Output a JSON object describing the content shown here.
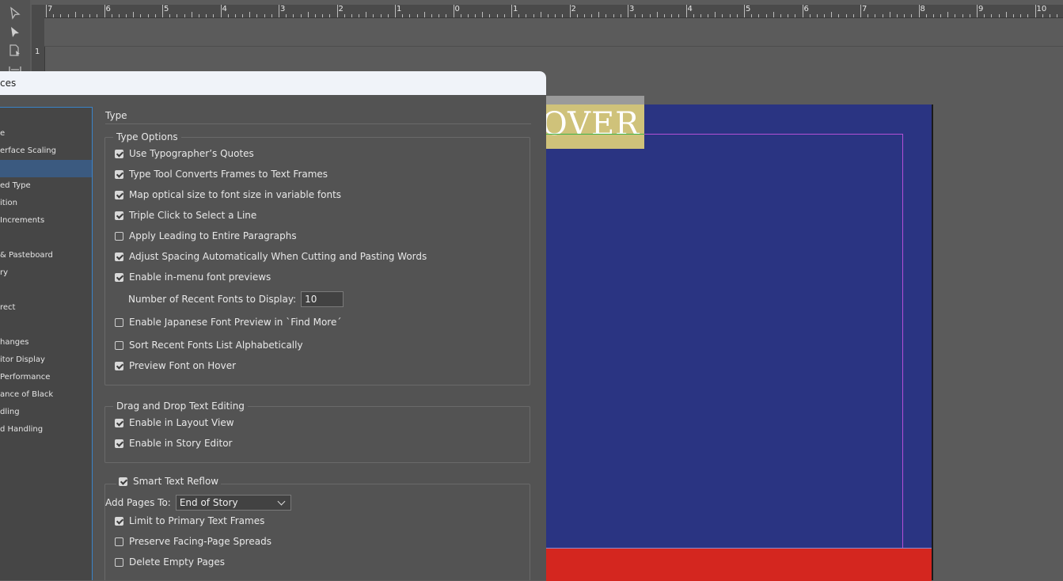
{
  "ruler": {
    "top_numbers": [
      "7",
      "6",
      "5",
      "4",
      "3",
      "2",
      "1",
      "0",
      "1",
      "2",
      "3",
      "4",
      "5",
      "6",
      "7",
      "8",
      "9",
      "10"
    ],
    "left_number": "1"
  },
  "canvas": {
    "cover_text": "OVER",
    "page_color": "#2a3482",
    "band_color": "#d4261f"
  },
  "dialog": {
    "title": "ces",
    "categories": [
      {
        "label": "e",
        "selected": false
      },
      {
        "label": "erface Scaling",
        "selected": false
      },
      {
        "label": "",
        "selected": true
      },
      {
        "label": "ed Type",
        "selected": false
      },
      {
        "label": "ition",
        "selected": false
      },
      {
        "label": " Increments",
        "selected": false
      },
      {
        "label": "",
        "selected": false
      },
      {
        "label": "& Pasteboard",
        "selected": false
      },
      {
        "label": "ry",
        "selected": false
      },
      {
        "label": "",
        "selected": false
      },
      {
        "label": "rect",
        "selected": false
      },
      {
        "label": "",
        "selected": false
      },
      {
        "label": "hanges",
        "selected": false
      },
      {
        "label": "itor Display",
        "selected": false
      },
      {
        "label": " Performance",
        "selected": false
      },
      {
        "label": "ance of Black",
        "selected": false
      },
      {
        "label": "dling",
        "selected": false
      },
      {
        "label": "d Handling",
        "selected": false
      }
    ],
    "section_title": "Type",
    "type_options": {
      "legend": "Type Options",
      "items": [
        {
          "label": "Use Typographer’s Quotes",
          "checked": true
        },
        {
          "label": "Type Tool Converts Frames to Text Frames",
          "checked": true
        },
        {
          "label": "Map optical size to font size in variable fonts",
          "checked": true
        },
        {
          "label": "Triple Click to Select a Line",
          "checked": true
        },
        {
          "label": "Apply Leading to Entire Paragraphs",
          "checked": false
        },
        {
          "label": "Adjust Spacing Automatically When Cutting and Pasting Words",
          "checked": true
        },
        {
          "label": "Enable in-menu font previews",
          "checked": true
        }
      ],
      "recent_fonts_label": "Number of Recent Fonts to Display:",
      "recent_fonts_value": "10",
      "items2": [
        {
          "label": "Enable Japanese Font Preview in `Find More´",
          "checked": false
        },
        {
          "label": "Sort Recent Fonts List Alphabetically",
          "checked": false
        },
        {
          "label": "Preview Font on Hover",
          "checked": true
        }
      ]
    },
    "drag_drop": {
      "legend": "Drag and Drop Text Editing",
      "items": [
        {
          "label": "Enable in Layout View",
          "checked": true
        },
        {
          "label": "Enable in Story Editor",
          "checked": true
        }
      ]
    },
    "smart_reflow": {
      "legend": "Smart Text Reflow",
      "checked": true,
      "add_pages_label": "Add Pages To:",
      "add_pages_value": "End of Story",
      "items": [
        {
          "label": "Limit to Primary Text Frames",
          "checked": true
        },
        {
          "label": "Preserve Facing-Page Spreads",
          "checked": false
        },
        {
          "label": "Delete Empty Pages",
          "checked": false
        }
      ]
    }
  }
}
